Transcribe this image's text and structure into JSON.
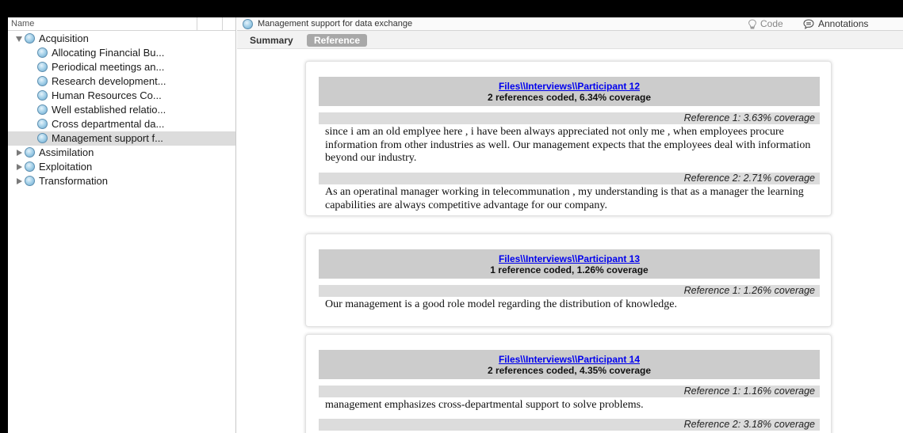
{
  "tree": {
    "header": "Name",
    "nodes": [
      {
        "label": "Acquisition",
        "expanded": true
      },
      {
        "label": "Allocating Financial Bu..."
      },
      {
        "label": "Periodical meetings an..."
      },
      {
        "label": "Research development..."
      },
      {
        "label": "Human Resources Co..."
      },
      {
        "label": "Well established relatio..."
      },
      {
        "label": "Cross departmental da..."
      },
      {
        "label": "Management support f...",
        "selected": true
      },
      {
        "label": "Assimilation",
        "expanded": false
      },
      {
        "label": "Exploitation",
        "expanded": false
      },
      {
        "label": "Transformation",
        "expanded": false
      }
    ]
  },
  "detail": {
    "title": "Management support for data exchange",
    "code_label": "Code",
    "annotations_label": "Annotations",
    "tabs": {
      "summary": "Summary",
      "reference": "Reference"
    }
  },
  "cards": [
    {
      "file": "Files\\\\Interviews\\\\Participant 12",
      "stats": "2 references coded, 6.34% coverage",
      "refs": [
        {
          "head": "Reference 1: 3.63% coverage",
          "text": "since i am an old emplyee here , i have been always appreciated not only me , when employees procure information from other industries as well. Our management expects that the employees deal with information beyond our industry."
        },
        {
          "head": "Reference 2: 2.71% coverage",
          "text": "As an operatinal manager working in telecommunation , my understanding is that as a manager the learning capabilities are always  competitive advantage for our company."
        }
      ]
    },
    {
      "file": "Files\\\\Interviews\\\\Participant 13",
      "stats": "1 reference coded, 1.26% coverage",
      "refs": [
        {
          "head": "Reference 1: 1.26% coverage",
          "text": "Our management is a good role model regarding the distribution of knowledge."
        }
      ]
    },
    {
      "file": "Files\\\\Interviews\\\\Participant 14",
      "stats": "2 references coded, 4.35% coverage",
      "refs": [
        {
          "head": "Reference 1: 1.16% coverage",
          "text": "management emphasizes cross-departmental support to solve problems."
        },
        {
          "head": "Reference 2: 3.18% coverage",
          "text": ""
        }
      ]
    }
  ]
}
